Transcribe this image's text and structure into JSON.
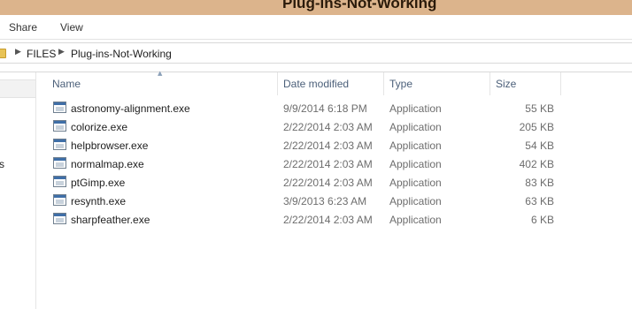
{
  "window": {
    "title": "Plug-ins-Not-Working"
  },
  "ribbon": {
    "tabs": [
      "Share",
      "View"
    ]
  },
  "address": {
    "crumbs": [
      "FILES",
      "Plug-ins-Not-Working"
    ]
  },
  "navpane": {
    "partial_label": "s"
  },
  "columns": {
    "name": "Name",
    "date": "Date modified",
    "type": "Type",
    "size": "Size"
  },
  "files": [
    {
      "name": "astronomy-alignment.exe",
      "date": "9/9/2014 6:18 PM",
      "type": "Application",
      "size": "55 KB"
    },
    {
      "name": "colorize.exe",
      "date": "2/22/2014 2:03 AM",
      "type": "Application",
      "size": "205 KB"
    },
    {
      "name": "helpbrowser.exe",
      "date": "2/22/2014 2:03 AM",
      "type": "Application",
      "size": "54 KB"
    },
    {
      "name": "normalmap.exe",
      "date": "2/22/2014 2:03 AM",
      "type": "Application",
      "size": "402 KB"
    },
    {
      "name": "ptGimp.exe",
      "date": "2/22/2014 2:03 AM",
      "type": "Application",
      "size": "83 KB"
    },
    {
      "name": "resynth.exe",
      "date": "3/9/2013 6:23 AM",
      "type": "Application",
      "size": "63 KB"
    },
    {
      "name": "sharpfeather.exe",
      "date": "2/22/2014 2:03 AM",
      "type": "Application",
      "size": "6 KB"
    }
  ],
  "icons": {
    "file": "application-exe-icon",
    "folder": "folder-icon",
    "breadcrumb": "chevron-right-icon",
    "sort": "sort-ascending-icon"
  },
  "colors": {
    "titlebar": "#dcb48c",
    "header_text": "#4c607a",
    "secondary_text": "#6d6d6d"
  }
}
